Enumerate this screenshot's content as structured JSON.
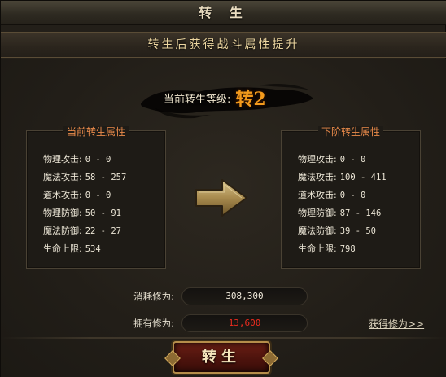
{
  "window": {
    "title": "转 生",
    "subtitle": "转生后获得战斗属性提升"
  },
  "rebirth": {
    "level_label": "当前转生等级:",
    "level_value": "转2"
  },
  "current_panel": {
    "title": "当前转生属性",
    "stats": [
      {
        "label": "物理攻击:",
        "value": "0 - 0"
      },
      {
        "label": "魔法攻击:",
        "value": "58 - 257"
      },
      {
        "label": "道术攻击:",
        "value": "0 - 0"
      },
      {
        "label": "物理防御:",
        "value": "50 - 91"
      },
      {
        "label": "魔法防御:",
        "value": "22 - 27"
      },
      {
        "label": "生命上限:",
        "value": "534"
      }
    ]
  },
  "next_panel": {
    "title": "下阶转生属性",
    "stats": [
      {
        "label": "物理攻击:",
        "value": "0 - 0"
      },
      {
        "label": "魔法攻击:",
        "value": "100 - 411"
      },
      {
        "label": "道术攻击:",
        "value": "0 - 0"
      },
      {
        "label": "物理防御:",
        "value": "87 - 146"
      },
      {
        "label": "魔法防御:",
        "value": "39 - 50"
      },
      {
        "label": "生命上限:",
        "value": "798"
      }
    ]
  },
  "cost": {
    "consume_label": "消耗修为:",
    "consume_value": "308,300",
    "own_label": "拥有修为:",
    "own_value": "13,600",
    "own_color": "#ee2c1f"
  },
  "get_link": "获得修为>>",
  "action_button": "转生",
  "icons": {
    "arrow": "right-arrow-icon"
  }
}
